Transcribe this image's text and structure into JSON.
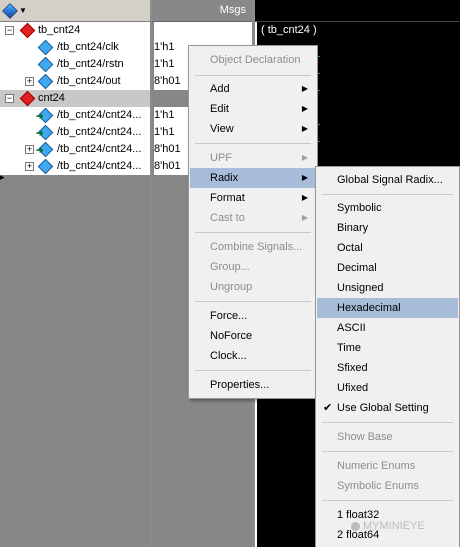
{
  "tree": {
    "rows": [
      {
        "label": "tb_cnt24",
        "kind": "module",
        "expander": "−",
        "indent": 0
      },
      {
        "label": "/tb_cnt24/clk",
        "kind": "signal",
        "indent": 1
      },
      {
        "label": "/tb_cnt24/rstn",
        "kind": "signal",
        "indent": 1
      },
      {
        "label": "/tb_cnt24/out",
        "kind": "bus",
        "expander": "+",
        "indent": 1
      },
      {
        "label": "cnt24",
        "kind": "module",
        "expander": "−",
        "indent": 0
      },
      {
        "label": "/tb_cnt24/cnt24...",
        "kind": "port",
        "indent": 1
      },
      {
        "label": "/tb_cnt24/cnt24...",
        "kind": "port",
        "indent": 1
      },
      {
        "label": "/tb_cnt24/cnt24...",
        "kind": "port-bus",
        "expander": "+",
        "indent": 1
      },
      {
        "label": "/tb_cnt24/cnt24...",
        "kind": "signal-bus",
        "expander": "+",
        "indent": 1
      }
    ]
  },
  "msgs": {
    "title": "Msgs",
    "values": [
      "",
      "1'h1",
      "1'h1",
      "8'h01",
      "",
      "1'h1",
      "1'h1",
      "8'h01",
      "8'h01"
    ]
  },
  "wave": {
    "module_label": "( tb_cnt24 )"
  },
  "menu": {
    "object_declaration": "Object Declaration",
    "add": "Add",
    "edit": "Edit",
    "view": "View",
    "upf": "UPF",
    "radix": "Radix",
    "format": "Format",
    "cast_to": "Cast to",
    "combine_signals": "Combine Signals...",
    "group": "Group...",
    "ungroup": "Ungroup",
    "force": "Force...",
    "noforce": "NoForce",
    "clock": "Clock...",
    "properties": "Properties..."
  },
  "submenu": {
    "global_signal_radix": "Global Signal Radix...",
    "symbolic": "Symbolic",
    "binary": "Binary",
    "octal": "Octal",
    "decimal": "Decimal",
    "unsigned": "Unsigned",
    "hexadecimal": "Hexadecimal",
    "ascii": "ASCII",
    "time": "Time",
    "sfixed": "Sfixed",
    "ufixed": "Ufixed",
    "use_global_setting": "Use Global Setting",
    "show_base": "Show Base",
    "numeric_enums": "Numeric Enums",
    "symbolic_enums": "Symbolic Enums",
    "float32": "1 float32",
    "float64": "2 float64"
  },
  "icons": {
    "submenu_arrow": "▶",
    "checkmark": "✔"
  },
  "watermark": "MYMINIEYE",
  "colors": {
    "highlight": "#a6bcd9",
    "wave": "#1fbf3a"
  }
}
